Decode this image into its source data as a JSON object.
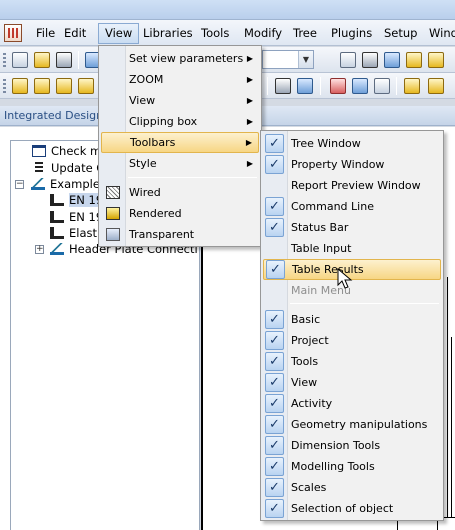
{
  "menubar": {
    "items": [
      "File",
      "Edit",
      "View",
      "Libraries",
      "Tools",
      "Modify",
      "Tree",
      "Plugins",
      "Setup",
      "Windo"
    ]
  },
  "panel": {
    "title": "Integrated Design"
  },
  "tree": {
    "items": [
      {
        "label": "Check m",
        "icon": "window-icon"
      },
      {
        "label": "Update C",
        "icon": "list-icon"
      },
      {
        "label": "Example",
        "icon": "structure-icon"
      },
      {
        "label": "EN 19",
        "icon": "steel-member-icon",
        "selected": true
      },
      {
        "label": "EN 19",
        "icon": "steel-member-icon"
      },
      {
        "label": "Elasti",
        "icon": "steel-member-icon"
      },
      {
        "label": "Header Plate Connecti",
        "icon": "connection-icon"
      }
    ]
  },
  "view_menu": {
    "items": [
      {
        "label": "Set view parameters",
        "submenu": true
      },
      {
        "label": "ZOOM",
        "submenu": true
      },
      {
        "label": "View",
        "submenu": true
      },
      {
        "label": "Clipping box",
        "submenu": true
      },
      {
        "label": "Toolbars",
        "submenu": true,
        "highlighted": true
      },
      {
        "label": "Style",
        "submenu": true
      },
      {
        "label": "Wired",
        "icon": "wired-icon"
      },
      {
        "label": "Rendered",
        "icon": "rendered-icon"
      },
      {
        "label": "Transparent",
        "icon": "transparent-icon"
      }
    ]
  },
  "toolbars_menu": {
    "items": [
      {
        "label": "Tree Window",
        "checked": true
      },
      {
        "label": "Property Window",
        "checked": true
      },
      {
        "label": "Report Preview Window",
        "checked": false
      },
      {
        "label": "Command Line",
        "checked": true
      },
      {
        "label": "Status Bar",
        "checked": true
      },
      {
        "label": "Table Input",
        "checked": false
      },
      {
        "label": "Table Results",
        "checked": true,
        "highlighted": true
      },
      {
        "label": "Main Menu",
        "checked": false,
        "disabled": true
      },
      {
        "label": "Basic",
        "checked": true
      },
      {
        "label": "Project",
        "checked": true
      },
      {
        "label": "Tools",
        "checked": true
      },
      {
        "label": "View",
        "checked": true
      },
      {
        "label": "Activity",
        "checked": true
      },
      {
        "label": "Geometry manipulations",
        "checked": true
      },
      {
        "label": "Dimension Tools",
        "checked": true
      },
      {
        "label": "Modelling Tools",
        "checked": true
      },
      {
        "label": "Scales",
        "checked": true
      },
      {
        "label": "Selection of object",
        "checked": true
      }
    ]
  },
  "glyphs": {
    "check": "✓",
    "submenu_arrow": "▶",
    "combo_arrow": "▼",
    "expand": "+",
    "collapse": "−"
  },
  "colors": {
    "menu_highlight": "#f7d684",
    "selection": "#c7d6ec",
    "panel_title": "#2a4f84"
  }
}
